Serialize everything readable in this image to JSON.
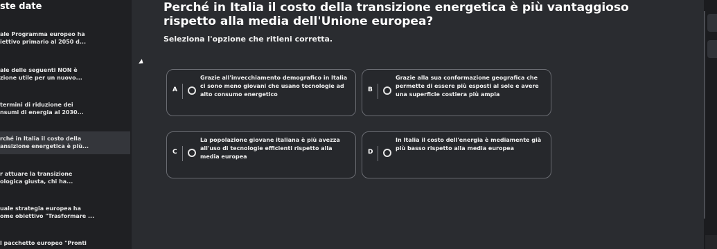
{
  "sidebar": {
    "title": "ste date",
    "items": [
      {
        "lines": [
          "ale Programma europeo ha",
          "iettivo primario al 2050 d..."
        ],
        "active": false
      },
      {
        "lines": [
          "ale delle seguenti NON è",
          "zione utile per un nuovo..."
        ],
        "active": false
      },
      {
        "lines": [
          "termini di riduzione dei",
          "nsumi di energia al 2030..."
        ],
        "active": false
      },
      {
        "lines": [
          "rché in Italia il costo della",
          "ansizione energetica è più..."
        ],
        "active": true
      },
      {
        "lines": [
          "r attuare la transizione",
          "ologica giusta, chi ha..."
        ],
        "active": false
      },
      {
        "lines": [
          "uale strategia europea ha",
          "ome obiettivo \"Trasformare ..."
        ],
        "active": false
      },
      {
        "lines": [
          "l pacchetto europeo \"Pronti"
        ],
        "active": false
      }
    ]
  },
  "question": {
    "title_line1": "Perché in Italia il costo della transizione energetica è più vantaggioso",
    "title_line2": "rispetto alla media dell'Unione europea?",
    "instruction": "Seleziona l'opzione che ritieni corretta."
  },
  "options": [
    {
      "letter": "A",
      "text": "Grazie all'invecchiamento demografico in Italia ci sono meno giovani che usano tecnologie ad alto consumo energetico"
    },
    {
      "letter": "B",
      "text": "Grazie alla sua conformazione geografica che permette di essere più esposti al sole e avere una superficie costiera più ampia"
    },
    {
      "letter": "C",
      "text": "La popolazione giovane italiana è più avezza all'uso di tecnologie efficienti rispetto alla media europea"
    },
    {
      "letter": "D",
      "text": "In Italia il costo dell'energia è mediamente già più basso rispetto alla media europea"
    }
  ]
}
